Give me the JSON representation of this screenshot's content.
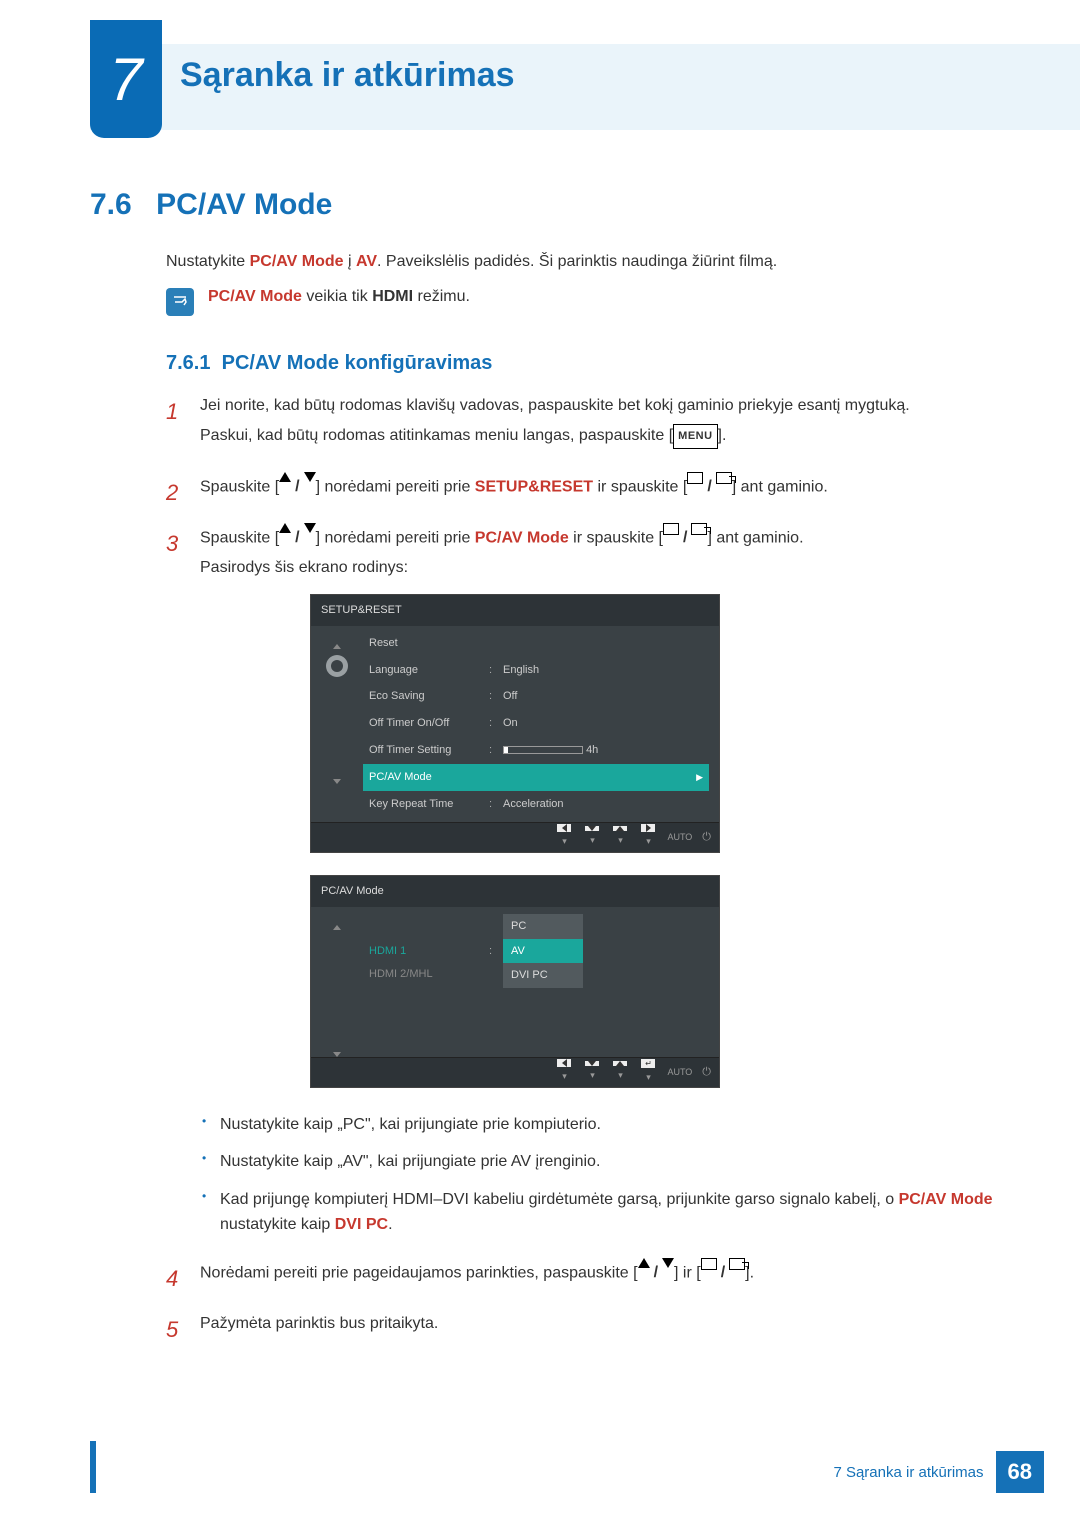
{
  "chapter": {
    "number": "7",
    "title": "Sąranka ir atkūrimas"
  },
  "section": {
    "number": "7.6",
    "title": "PC/AV Mode"
  },
  "intro": {
    "prefix": "Nustatykite ",
    "em1": "PC/AV Mode",
    "mid": " į ",
    "em2": "AV",
    "suffix": ". Paveikslėlis padidės. Ši parinktis naudinga žiūrint filmą."
  },
  "note": {
    "em": "PC/AV Mode",
    "mid": " veikia tik ",
    "em2": "HDMI",
    "suffix": " režimu."
  },
  "subsection": {
    "number": "7.6.1",
    "title": "PC/AV Mode konfigūravimas"
  },
  "steps": {
    "s1a": "Jei norite, kad būtų rodomas klavišų vadovas, paspauskite bet kokį gaminio priekyje esantį mygtuką.",
    "s1b_pre": "Paskui, kad būtų rodomas atitinkamas meniu langas, paspauskite [",
    "s1b_menu": "MENU",
    "s1b_post": "].",
    "s2_pre": "Spauskite [",
    "s2_mid": "] norėdami pereiti prie ",
    "s2_em": "SETUP&RESET",
    "s2_mid2": " ir spauskite [",
    "s2_post": "] ant gaminio.",
    "s3_pre": "Spauskite [",
    "s3_mid": "] norėdami pereiti prie ",
    "s3_em": "PC/AV Mode",
    "s3_mid2": " ir spauskite [",
    "s3_post": "] ant gaminio.",
    "s3_line2": "Pasirodys šis ekrano rodinys:",
    "s4_pre": "Norėdami pereiti prie pageidaujamos parinkties, paspauskite [",
    "s4_mid": "] ir [",
    "s4_post": "].",
    "s5": "Pažymėta parinktis bus pritaikyta."
  },
  "bullets": {
    "b1": "Nustatykite kaip „PC\", kai prijungiate prie kompiuterio.",
    "b2": "Nustatykite kaip „AV\", kai prijungiate prie AV įrenginio.",
    "b3_pre": "Kad prijungę kompiuterį HDMI–DVI kabeliu girdėtumėte garsą, prijunkite garso signalo kabelį, o ",
    "b3_em1": "PC/AV Mode",
    "b3_mid": " nustatykite kaip ",
    "b3_em2": "DVI PC",
    "b3_post": "."
  },
  "osd1": {
    "title": "SETUP&RESET",
    "rows": [
      {
        "label": "Reset",
        "value": ""
      },
      {
        "label": "Language",
        "value": "English"
      },
      {
        "label": "Eco Saving",
        "value": "Off"
      },
      {
        "label": "Off Timer On/Off",
        "value": "On"
      },
      {
        "label": "Off Timer Setting",
        "value": "4h",
        "slider": true
      },
      {
        "label": "PC/AV Mode",
        "value": "",
        "hl": true
      },
      {
        "label": "Key Repeat Time",
        "value": "Acceleration"
      }
    ],
    "foot_auto": "AUTO"
  },
  "osd2": {
    "title": "PC/AV Mode",
    "hdmi1": "HDMI 1",
    "hdmi2": "HDMI 2/MHL",
    "opts": [
      "PC",
      "AV",
      "DVI PC"
    ],
    "foot_auto": "AUTO"
  },
  "footer": {
    "text": "7 Sąranka ir atkūrimas",
    "page": "68"
  }
}
